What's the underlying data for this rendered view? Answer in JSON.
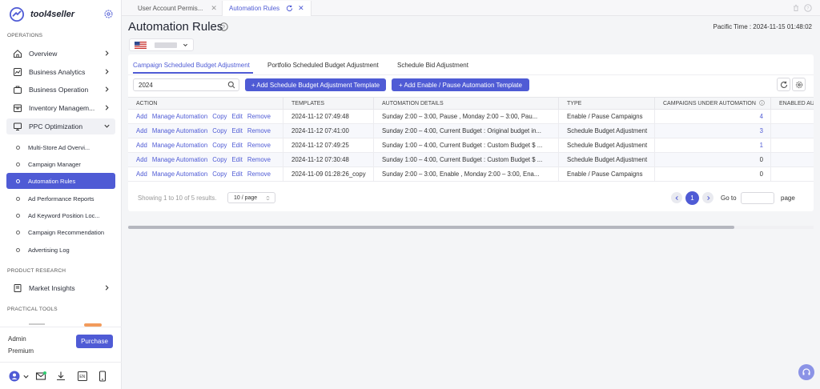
{
  "app": {
    "name": "tool4seller"
  },
  "sidebar": {
    "sections": {
      "operations": "OPERATIONS",
      "product_research": "PRODUCT RESEARCH",
      "practical_tools": "PRACTICAL TOOLS"
    },
    "items": [
      {
        "label": "Overview",
        "icon": "home-icon"
      },
      {
        "label": "Business Analytics",
        "icon": "chart-icon"
      },
      {
        "label": "Business Operation",
        "icon": "briefcase-icon"
      },
      {
        "label": "Inventory Managem...",
        "icon": "box-icon"
      },
      {
        "label": "PPC Optimization",
        "icon": "monitor-icon"
      }
    ],
    "ppc_children": [
      "Multi-Store Ad Overvi...",
      "Campaign Manager",
      "Automation Rules",
      "Ad Performance Reports",
      "Ad Keyword Position Loc...",
      "Campaign Recommendation",
      "Advertising Log"
    ],
    "market_insights": "Market Insights",
    "account": {
      "role": "Admin",
      "plan": "Premium",
      "purchase_label": "Purchase"
    }
  },
  "tabs": [
    {
      "label": "User Account Permis...",
      "active": false
    },
    {
      "label": "Automation Rules",
      "active": true
    }
  ],
  "page": {
    "title": "Automation Rules",
    "pacific_time": "Pacific Time : 2024-11-15 01:48:02"
  },
  "subtabs": [
    "Campaign Scheduled Budget Adjustment",
    "Portfolio Scheduled Budget Adjustment",
    "Schedule Bid Adjustment"
  ],
  "toolbar": {
    "search_value": "2024",
    "add_budget_template": "+ Add Schedule Budget Adjustment Template",
    "add_pause_template": "+ Add Enable / Pause Automation Template"
  },
  "table": {
    "columns": [
      "ACTION",
      "TEMPLATES",
      "AUTOMATION DETAILS",
      "TYPE",
      "CAMPAIGNS UNDER AUTOMATION",
      "ENABLED AU"
    ],
    "actions": [
      "Add",
      "Manage Automation",
      "Copy",
      "Edit",
      "Remove"
    ],
    "rows": [
      {
        "template": "2024-11-12 07:49:48",
        "details": "Sunday  2:00 – 3:00,  Pause , Monday  2:00 – 3:00,  Pau...",
        "type": "Enable / Pause Campaigns",
        "campaigns": "4"
      },
      {
        "template": "2024-11-12 07:41:00",
        "details": "Sunday  2:00 – 4:00,  Current Budget : Original budget in...",
        "type": "Schedule Budget Adjustment",
        "campaigns": "3"
      },
      {
        "template": "2024-11-12 07:49:25",
        "details": "Sunday  1:00 – 4:00,  Current Budget : Custom Budget $ ...",
        "type": "Schedule Budget Adjustment",
        "campaigns": "1"
      },
      {
        "template": "2024-11-12 07:30:48",
        "details": "Sunday  1:00 – 4:00,  Current Budget : Custom Budget $ ...",
        "type": "Schedule Budget Adjustment",
        "campaigns": "0"
      },
      {
        "template": "2024-11-09 01:28:26_copy",
        "details": "Sunday  2:00 – 3:00,  Enable , Monday  2:00 – 3:00,  Ena...",
        "type": "Enable / Pause Campaigns",
        "campaigns": "0"
      }
    ]
  },
  "pagination": {
    "summary": "Showing 1 to 10 of 5 results.",
    "page_size": "10 / page",
    "current_page": "1",
    "goto_label": "Go to",
    "page_label": "page"
  },
  "colors": {
    "accent": "#4f5bd5",
    "link": "#4f5bd5"
  }
}
